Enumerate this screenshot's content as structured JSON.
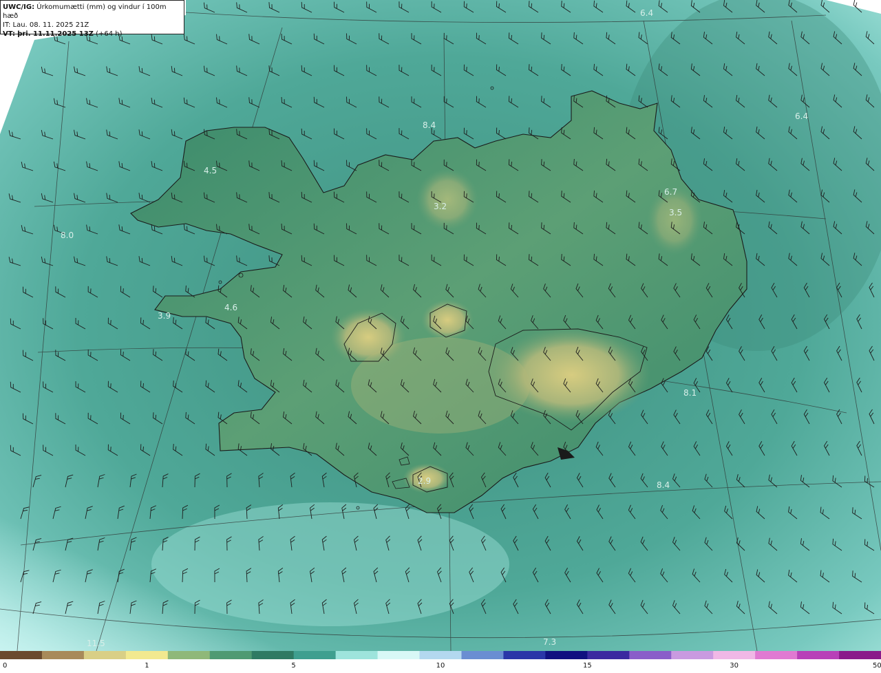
{
  "header": {
    "model": "UWC/IG:",
    "title": "Úrkomumætti (mm) og vindur í 100m hæð",
    "init_label": "IT:",
    "init_time": "Lau. 08. 11. 2025 21Z",
    "valid_label": "VT:",
    "valid_time": "þri. 11.11.2025 13Z",
    "lead": "(+64 h)"
  },
  "map_labels": [
    {
      "id": "6-4-ne-top",
      "text": "6.4"
    },
    {
      "id": "6-4-ne",
      "text": "6.4"
    },
    {
      "id": "8-4-n",
      "text": "8.4"
    },
    {
      "id": "4-5-westfjords",
      "text": "4.5"
    },
    {
      "id": "3-2-north",
      "text": "3.2"
    },
    {
      "id": "6-7-east",
      "text": "6.7"
    },
    {
      "id": "3-5-east",
      "text": "3.5"
    },
    {
      "id": "8-0-west",
      "text": "8.0"
    },
    {
      "id": "3-9-snaefellsnes",
      "text": "3.9"
    },
    {
      "id": "4-6-west",
      "text": "4.6"
    },
    {
      "id": "8-1-southeast",
      "text": "8.1"
    },
    {
      "id": "2-9-south",
      "text": "2.9"
    },
    {
      "id": "8-4-south",
      "text": "8.4"
    },
    {
      "id": "11-5-southwest",
      "text": "11.5"
    },
    {
      "id": "7-3-south",
      "text": "7.3"
    }
  ],
  "colorbar": {
    "ticks": [
      {
        "value": "0",
        "frac": 0.0
      },
      {
        "value": "1",
        "frac": 0.1667
      },
      {
        "value": "5",
        "frac": 0.3333
      },
      {
        "value": "10",
        "frac": 0.5
      },
      {
        "value": "15",
        "frac": 0.6667
      },
      {
        "value": "30",
        "frac": 0.8333
      },
      {
        "value": "50",
        "frac": 1.0
      }
    ],
    "colors": [
      "#6b4a2e",
      "#a88a5a",
      "#d9cf86",
      "#f2e98f",
      "#8fb879",
      "#4f9a73",
      "#2f7a63",
      "#3f9f8f",
      "#9ee4dc",
      "#d8f8f6",
      "#b3d8ef",
      "#6a8ed2",
      "#2a36a8",
      "#101080",
      "#3b2aa0",
      "#8a5ec9",
      "#c99ae0",
      "#f0b8e6",
      "#e07ad2",
      "#b840b8",
      "#8a1a8a"
    ]
  },
  "colors": {
    "sea_deep": "#3e8f84",
    "sea_light": "#7fd0c6",
    "land_low": "#3d8a6e",
    "land_high": "#c9c47a",
    "coast": "#1a1a1a",
    "barb": "#1a1a1a"
  }
}
